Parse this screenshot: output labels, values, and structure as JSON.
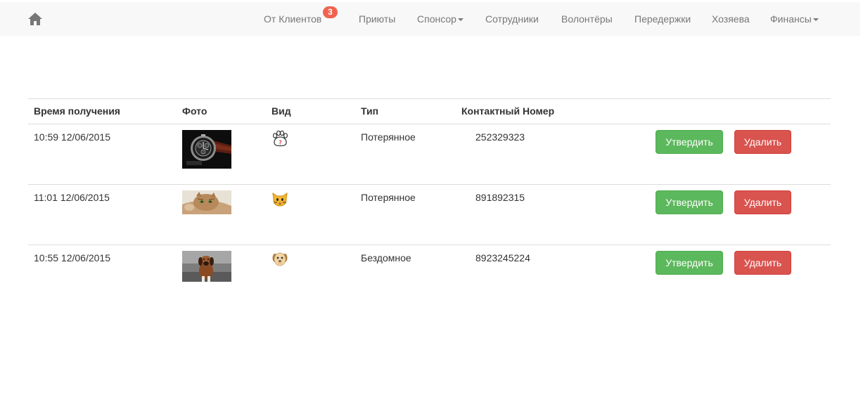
{
  "navbar": {
    "home_icon": "home-icon",
    "items": [
      {
        "label": "От Клиентов",
        "badge": "3",
        "dropdown": false
      },
      {
        "label": "Приюты",
        "dropdown": false
      },
      {
        "label": "Спонсор",
        "dropdown": true
      },
      {
        "label": "Сотрудники",
        "dropdown": false
      },
      {
        "label": "Волонтёры",
        "dropdown": false
      },
      {
        "label": "Передержки",
        "dropdown": false
      },
      {
        "label": "Хозяева",
        "dropdown": false
      },
      {
        "label": "Финансы",
        "dropdown": true
      }
    ]
  },
  "table": {
    "headers": {
      "time": "Время получения",
      "photo": "Фото",
      "species": "Вид",
      "type": "Тип",
      "phone": "Контактный Номер"
    },
    "rows": [
      {
        "time": "10:59 12/06/2015",
        "photo": "wristwatch-photo",
        "species_icon": "paw-question-icon",
        "type": "Потерянное",
        "phone": "252329323",
        "approve": "Утвердить",
        "delete": "Удалить"
      },
      {
        "time": "11:01 12/06/2015",
        "photo": "cat-photo",
        "species_icon": "cat-face-icon",
        "type": "Потерянное",
        "phone": "891892315",
        "approve": "Утвердить",
        "delete": "Удалить"
      },
      {
        "time": "10:55 12/06/2015",
        "photo": "puppy-photo",
        "species_icon": "dog-face-icon",
        "type": "Бездомное",
        "phone": "8923245224",
        "approve": "Утвердить",
        "delete": "Удалить"
      }
    ]
  },
  "colors": {
    "navbar_bg": "#f8f8f8",
    "nav_text": "#777777",
    "badge": "#f0624f",
    "success": "#5cb85c",
    "danger": "#d9534f",
    "rule": "#dddddd"
  }
}
